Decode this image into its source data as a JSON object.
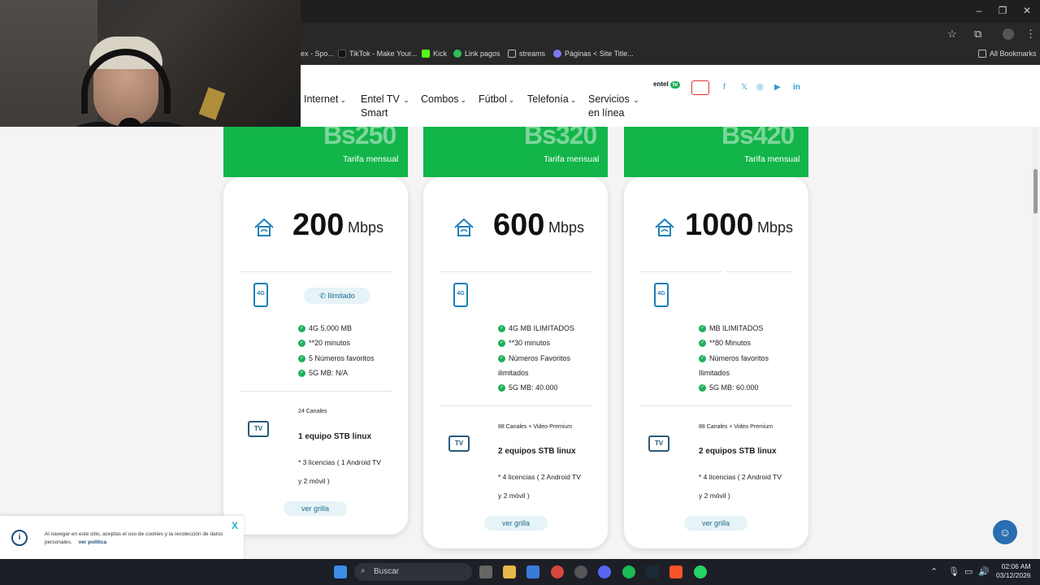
{
  "browser": {
    "bookmarks": [
      {
        "label": "ex - Spo..."
      },
      {
        "label": "TikTok - Make Your..."
      },
      {
        "label": "Kick"
      },
      {
        "label": "Link pagos"
      },
      {
        "label": "streams"
      },
      {
        "label": "Páginas < Site Title..."
      }
    ],
    "all_bookmarks": "All Bookmarks"
  },
  "nav": {
    "items": [
      "Internet",
      "Entel TV",
      "Smart",
      "Combos",
      "Fútbol",
      "Telefonía",
      "Servicios",
      "en línea"
    ]
  },
  "brand": {
    "entel": "entel",
    "tv": "tv"
  },
  "plans": [
    {
      "price": "Bs250",
      "tarifa": "Tarifa mensual",
      "speed": "200",
      "unit": "Mbps",
      "pill": "Ilimitado",
      "features": [
        "4G 5.000 MB",
        "**20 minutos",
        "5 Números favoritos",
        "5G MB: N/A"
      ],
      "channels": "24 Canales",
      "stb": "1 equipo STB linux",
      "lic1": "* 3 licencias ( 1 Android TV",
      "lic2": "y 2 móvil )",
      "grilla": "ver grilla"
    },
    {
      "price": "Bs320",
      "tarifa": "Tarifa mensual",
      "speed": "600",
      "unit": "Mbps",
      "features": [
        "4G MB ILIMITADOS",
        "**30 minutos",
        "Números Favoritos",
        "ilimitados",
        "5G MB: 40.000"
      ],
      "channels": "88 Canales + Video Premium",
      "stb": "2 equipos STB linux",
      "lic1": "* 4 licencias ( 2 Android TV",
      "lic2": "y 2 móvil )",
      "grilla": "ver grilla"
    },
    {
      "price": "Bs420",
      "tarifa": "Tarifa mensual",
      "speed": "1000",
      "unit": "Mbps",
      "features": [
        "MB ILIMITADOS",
        "**80 Minutos",
        "Números favoritos",
        "Ilimitados",
        "5G MB: 60.000"
      ],
      "channels": "88 Canales + Video Premium",
      "stb": "2 equipos STB linux",
      "lic1": "* 4 licencias ( 2 Android TV",
      "lic2": "y 2 móvil )",
      "grilla": "ver grilla"
    }
  ],
  "icons": {
    "phone": "4G",
    "tv": "TV"
  },
  "cookie": {
    "text": "Al navegar en este sitio, aceptas el uso de cookies y la recolección de datos personales.",
    "link": "ver política",
    "close": "X"
  },
  "taskbar": {
    "search": "Buscar",
    "time": "02:06 AM",
    "date": "03/12/2026"
  },
  "colors": {
    "brand_green": "#12b549",
    "accent_blue": "#1a7fb8"
  }
}
